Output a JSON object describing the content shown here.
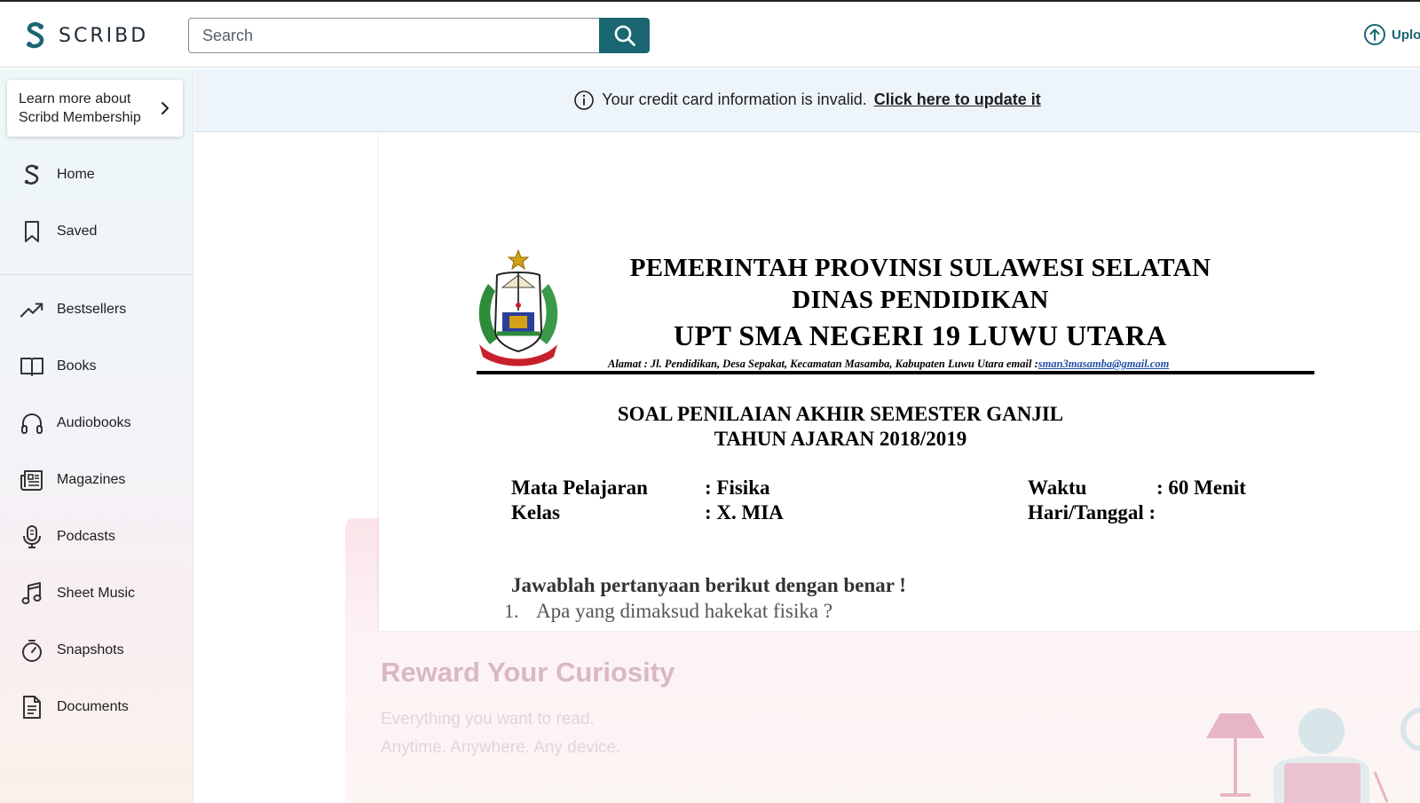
{
  "header": {
    "logo_text": "SCRIBD",
    "search_placeholder": "Search",
    "upload_label": "Uplo"
  },
  "sidebar": {
    "membership_line1": "Learn more about",
    "membership_line2": "Scribd Membership",
    "primary": [
      {
        "label": "Home",
        "icon": "scribd-icon"
      },
      {
        "label": "Saved",
        "icon": "bookmark-icon"
      }
    ],
    "categories": [
      {
        "label": "Bestsellers",
        "icon": "trending-icon"
      },
      {
        "label": "Books",
        "icon": "book-icon"
      },
      {
        "label": "Audiobooks",
        "icon": "headphones-icon"
      },
      {
        "label": "Magazines",
        "icon": "newspaper-icon"
      },
      {
        "label": "Podcasts",
        "icon": "microphone-icon"
      },
      {
        "label": "Sheet Music",
        "icon": "music-note-icon"
      },
      {
        "label": "Snapshots",
        "icon": "stopwatch-icon"
      },
      {
        "label": "Documents",
        "icon": "document-icon"
      }
    ]
  },
  "banner": {
    "message": "Your credit card information is invalid.",
    "link": "Click here to update it"
  },
  "document": {
    "kop_line1": "PEMERINTAH PROVINSI SULAWESI SELATAN",
    "kop_line2": "DINAS PENDIDIKAN",
    "kop_line3": "UPT SMA NEGERI 19 LUWU UTARA",
    "address": "Alamat : Jl. Pendidikan, Desa Sepakat, Kecamatan Masamba, Kabupaten Luwu Utara email :",
    "email": "sman3masamba@gmail.com",
    "exam_title": "SOAL PENILAIAN AKHIR SEMESTER GANJIL",
    "exam_year": "TAHUN AJARAN 2018/2019",
    "subject_label": "Mata Pelajaran",
    "subject_value": ": Fisika",
    "class_label": "Kelas",
    "class_value": ": X. MIA",
    "time_label": "Waktu",
    "time_value": ": 60 Menit",
    "date_label": "Hari/Tanggal :",
    "instruction": "Jawablah pertanyaan berikut dengan benar !",
    "question_1_number": "1.",
    "question_1": "Apa yang dimaksud hakekat fisika ?"
  },
  "promo": {
    "title": "Reward Your Curiosity",
    "line1": "Everything you want to read.",
    "line2": "Anytime. Anywhere. Any device."
  },
  "colors": {
    "accent": "#1b6673",
    "banner_bg": "#eef5fa",
    "promo_title": "#d9b7c3"
  }
}
